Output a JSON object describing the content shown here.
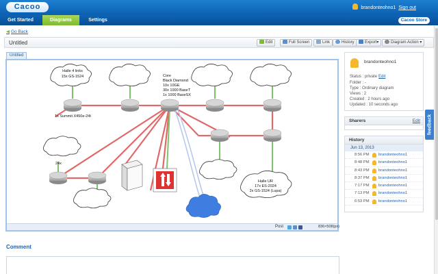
{
  "app": {
    "logo": "Cacoo",
    "user": "brandonteohno1",
    "signout": "Sign out"
  },
  "nav": {
    "tabs": [
      "Get Started",
      "Diagrams",
      "Settings"
    ],
    "active": "Diagrams",
    "store": "Cacoo Store"
  },
  "goback": "Go Back",
  "diagram": {
    "title": "Untitled",
    "tab_label": "Untitled"
  },
  "toolbar": {
    "edit": "Edit",
    "fullscreen": "Full Screen",
    "link": "Link",
    "history": "History",
    "export": "Export▾",
    "diagram_action": "Diagram Action ▾"
  },
  "canvas_footer": {
    "post": "Post",
    "size": "836×508(px)"
  },
  "diagram_labels": {
    "halle4": [
      "Halle 4 links",
      "15x GS-1524"
    ],
    "core": [
      "Core",
      "Black Diamond",
      "10x 10GE",
      "30x 1000 BaseT",
      "1x 1000 BaseSX"
    ],
    "summit": "1x Summit X450e-24t",
    "twentyfour": "24x",
    "halle_ur": [
      "Halle UR",
      "17x ES-2024",
      "2x GS-1524 (Lupa)"
    ]
  },
  "owner": {
    "name": "brandonteohno1",
    "status_label": "Status : ",
    "status_value": "private",
    "status_edit": "Edit",
    "folder": "Folder :  -",
    "type": "Type : Ordinary diagram",
    "views": "Views : 2",
    "created": "Created : 2 hours ago",
    "updated": "Updated : 10 seconds ago"
  },
  "sharers": {
    "title": "Sharers",
    "edit": "Edit"
  },
  "history": {
    "title": "History",
    "date": "Jun 13, 2013",
    "entries": [
      {
        "time": "8:56 PM",
        "user": "brandonteohno1"
      },
      {
        "time": "8:48 PM",
        "user": "brandonteohno1"
      },
      {
        "time": "8:43 PM",
        "user": "brandonteohno1"
      },
      {
        "time": "8:37 PM",
        "user": "brandonteohno1"
      },
      {
        "time": "7:17 PM",
        "user": "brandonteohno1"
      },
      {
        "time": "7:13 PM",
        "user": "brandonteohno1"
      },
      {
        "time": "6:53 PM",
        "user": "brandonteohno1"
      }
    ]
  },
  "comment": {
    "title": "Comment"
  },
  "feedback": "feedback",
  "colors": {
    "brand_blue": "#0b5fb0",
    "active_tab": "#7cbc2d",
    "link": "#1d62b5",
    "red_link": "#e06060",
    "green_link": "#7ec46a",
    "cloud_blue": "#3f7ee0"
  }
}
